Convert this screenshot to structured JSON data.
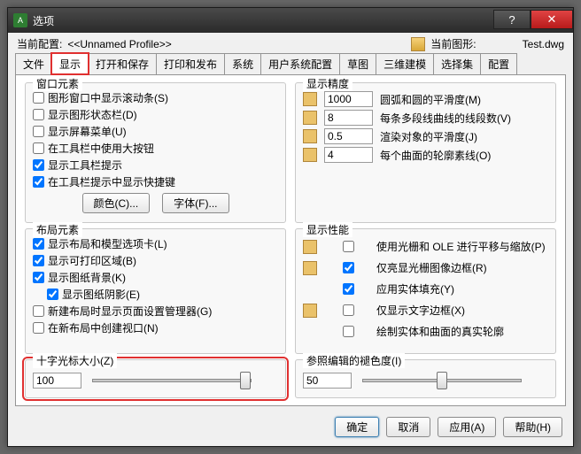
{
  "title": "选项",
  "help_icon": "?",
  "close_icon": "✕",
  "top": {
    "profile_label": "当前配置:",
    "profile_value": "<<Unnamed Profile>>",
    "drawing_label": "当前图形:",
    "drawing_value": "Test.dwg"
  },
  "tabs": [
    "文件",
    "显示",
    "打开和保存",
    "打印和发布",
    "系统",
    "用户系统配置",
    "草图",
    "三维建模",
    "选择集",
    "配置"
  ],
  "window_elements": {
    "title": "窗口元素",
    "c1": "图形窗口中显示滚动条(S)",
    "c2": "显示图形状态栏(D)",
    "c3": "显示屏幕菜单(U)",
    "c4": "在工具栏中使用大按钮",
    "c5": "显示工具栏提示",
    "c6": "在工具栏提示中显示快捷键",
    "btn_color": "颜色(C)...",
    "btn_font": "字体(F)..."
  },
  "resolution": {
    "title": "显示精度",
    "v1": "1000",
    "l1": "圆弧和圆的平滑度(M)",
    "v2": "8",
    "l2": "每条多段线曲线的线段数(V)",
    "v3": "0.5",
    "l3": "渲染对象的平滑度(J)",
    "v4": "4",
    "l4": "每个曲面的轮廓素线(O)"
  },
  "layout_elements": {
    "title": "布局元素",
    "c1": "显示布局和模型选项卡(L)",
    "c2": "显示可打印区域(B)",
    "c3": "显示图纸背景(K)",
    "c3a": "显示图纸阴影(E)",
    "c4": "新建布局时显示页面设置管理器(G)",
    "c5": "在新布局中创建视口(N)"
  },
  "performance": {
    "title": "显示性能",
    "c1": "使用光栅和 OLE 进行平移与缩放(P)",
    "c2": "仅亮显光栅图像边框(R)",
    "c3": "应用实体填充(Y)",
    "c4": "仅显示文字边框(X)",
    "c5": "绘制实体和曲面的真实轮廓"
  },
  "crosshair": {
    "title": "十字光标大小(Z)",
    "value": "100"
  },
  "fade": {
    "title": "参照编辑的褪色度(I)",
    "value": "50"
  },
  "footer": {
    "ok": "确定",
    "cancel": "取消",
    "apply": "应用(A)",
    "help": "帮助(H)"
  }
}
